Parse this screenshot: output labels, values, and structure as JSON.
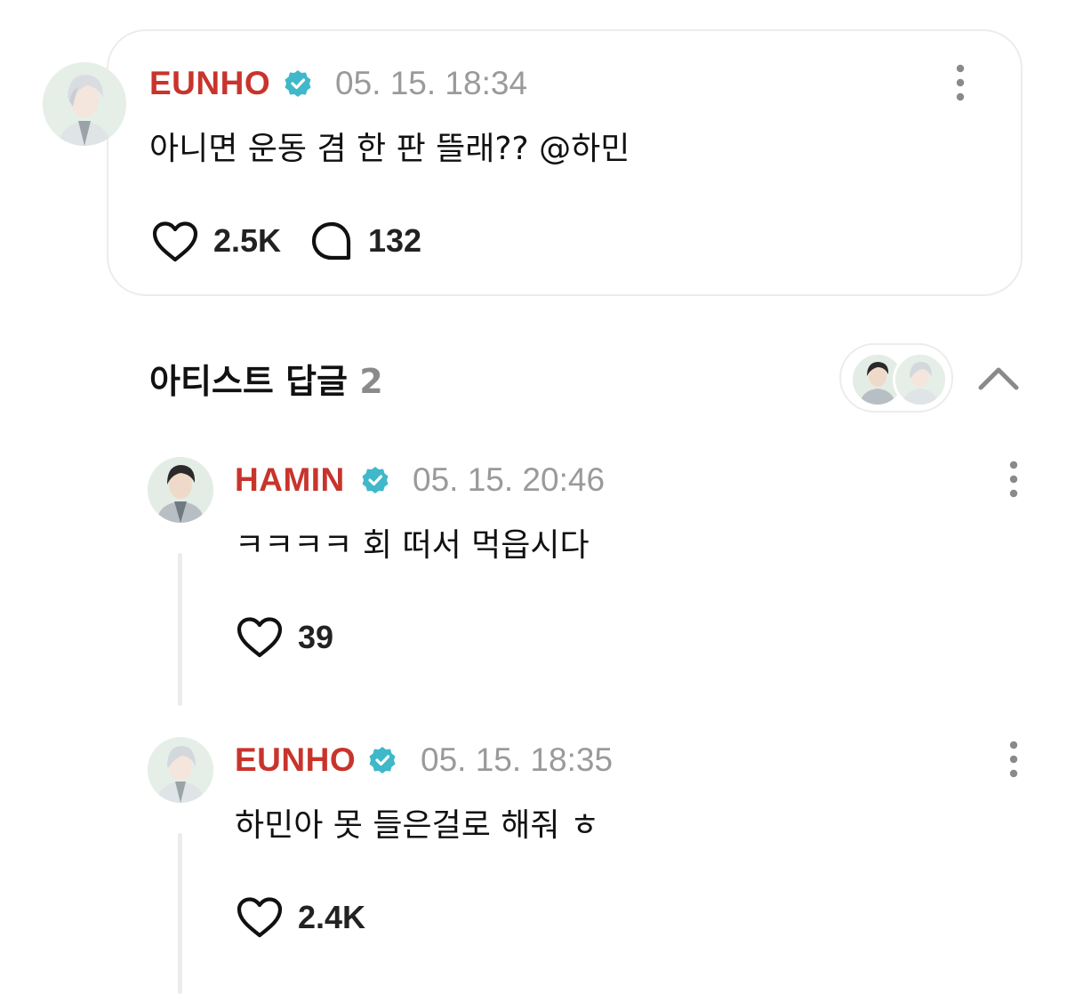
{
  "post": {
    "username": "EUNHO",
    "timestamp": "05. 15. 18:34",
    "text": "아니면 운동 겸 한 판 뜰래?? @하민",
    "likes": "2.5K",
    "comments": "132"
  },
  "artist_replies": {
    "title": "아티스트 답글",
    "count": "2"
  },
  "replies": [
    {
      "username": "HAMIN",
      "timestamp": "05. 15. 20:46",
      "text": "ㅋㅋㅋㅋ 회 떠서 먹읍시다",
      "likes": "39"
    },
    {
      "username": "EUNHO",
      "timestamp": "05. 15. 18:35",
      "text": "하민아 못 들은걸로 해줘 ㅎ",
      "likes": "2.4K"
    }
  ],
  "colors": {
    "username": "#c8342c",
    "verified": "#3fb8c9",
    "timestamp": "#9a9a9a",
    "border": "#ececec"
  },
  "icons": [
    "verified-badge-icon",
    "more-vertical-icon",
    "heart-icon",
    "comment-icon",
    "chevron-up-icon"
  ]
}
